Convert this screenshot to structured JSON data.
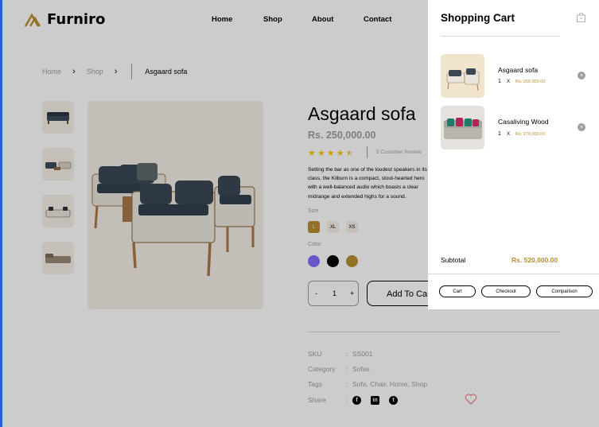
{
  "header": {
    "brand": "Furniro",
    "nav": [
      "Home",
      "Shop",
      "About",
      "Contact"
    ]
  },
  "breadcrumb": {
    "home": "Home",
    "shop": "Shop",
    "current": "Asgaard sofa"
  },
  "product": {
    "title": "Asgaard sofa",
    "price": "Rs. 250,000.00",
    "rating": 4.5,
    "reviews": "5 Customer Review",
    "description": "Setting the bar as one of the loudest speakers in its class, the Kilburn is a compact, stout-hearted hero with a well-balanced audio which boasts a clear midrange and extended highs for a sound.",
    "size_label": "Size",
    "sizes": [
      "L",
      "XL",
      "XS"
    ],
    "color_label": "Color",
    "colors": [
      "#816dfa",
      "#000000",
      "#b88e2f"
    ],
    "qty_minus": "-",
    "qty": "1",
    "qty_plus": "+",
    "add_to_cart": "Add To Cart",
    "meta": {
      "sku_k": "SKU",
      "sku_v": "SS001",
      "cat_k": "Category",
      "cat_v": "Sofas",
      "tags_k": "Tags",
      "tags_v": "Sofa, Chair, Home, Shop",
      "share_k": "Share",
      "colon": ":"
    }
  },
  "cart": {
    "title": "Shopping Cart",
    "items": [
      {
        "name": "Asgaard sofa",
        "qty": "1",
        "x": "X",
        "price": "Rs. 250,000.00"
      },
      {
        "name": "Casaliving Wood",
        "qty": "1",
        "x": "X",
        "price": "Rs. 270,000.00"
      }
    ],
    "subtotal_label": "Subtotal",
    "subtotal_value": "Rs. 520,000.00",
    "buttons": [
      "Cart",
      "Checkout",
      "Comparison"
    ]
  },
  "icons": {
    "share": [
      "facebook-icon",
      "linkedin-icon",
      "twitter-icon"
    ],
    "wishlist": "heart-icon",
    "close_cart": "bag-icon",
    "remove": "remove-icon"
  },
  "accent": "#b88e2f"
}
